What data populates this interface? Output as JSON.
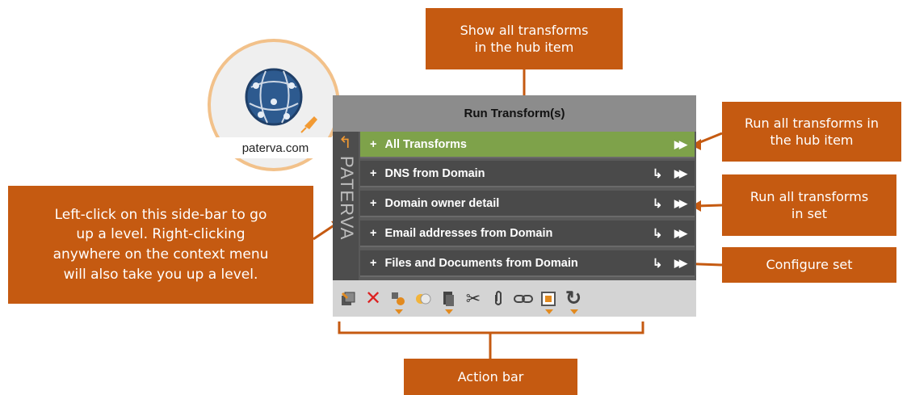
{
  "callouts": {
    "show_all": [
      "Show all transforms",
      "in the hub item"
    ],
    "run_hub": [
      "Run all transforms in",
      "the hub item"
    ],
    "run_set": [
      "Run all transforms",
      "in set"
    ],
    "configure": [
      "Configure set"
    ],
    "left_click": [
      "Left-click on this side-bar to go",
      "up a level. Right-clicking",
      "anywhere on the context menu",
      "will also take you up a level."
    ],
    "action_bar": [
      "Action bar"
    ]
  },
  "logo": {
    "text": "paterva.com"
  },
  "panel": {
    "title": "Run Transform(s)",
    "side_label": "PATERVA",
    "rows": [
      {
        "label": "All Transforms",
        "active": true,
        "configure": false
      },
      {
        "label": "DNS from Domain",
        "active": false,
        "configure": true
      },
      {
        "label": "Domain owner detail",
        "active": false,
        "configure": true
      },
      {
        "label": "Email addresses from Domain",
        "active": false,
        "configure": true
      },
      {
        "label": "Files and Documents from Domain",
        "active": false,
        "configure": true
      }
    ],
    "plus": "+",
    "actions": [
      "copy-to-graph-icon",
      "delete-icon",
      "type-icon",
      "bookmark-icon",
      "paste-icon",
      "cut-icon",
      "attach-icon",
      "link-icon",
      "select-icon",
      "refresh-icon"
    ]
  },
  "colors": {
    "callout": "#c55a11",
    "active_row": "#7ea24a",
    "accent": "#f29a33"
  }
}
